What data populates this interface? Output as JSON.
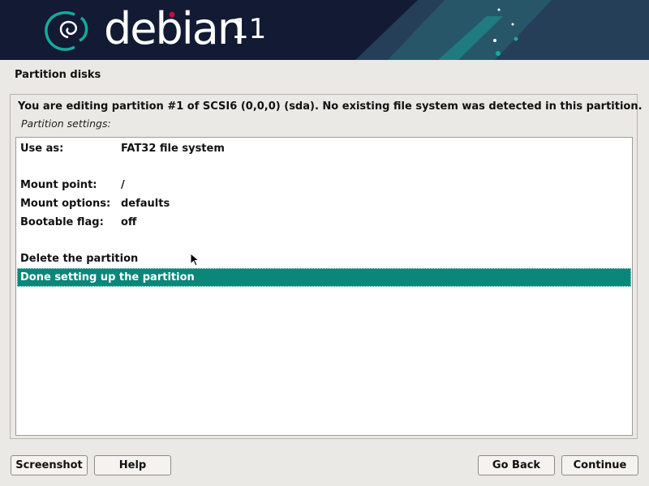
{
  "banner": {
    "name": "debian",
    "version": "11"
  },
  "page_title": "Partition disks",
  "description": "You are editing partition #1 of SCSI6 (0,0,0) (sda). No existing file system was detected in this partition.",
  "settings_label": "Partition settings:",
  "options": [
    {
      "label": "Use as:",
      "value": "FAT32 file system"
    },
    {
      "label": "Mount point:",
      "value": "/"
    },
    {
      "label": "Mount options:",
      "value": "defaults"
    },
    {
      "label": "Bootable flag:",
      "value": "off"
    },
    {
      "label": "Delete the partition",
      "value": ""
    },
    {
      "label": "Done setting up the partition",
      "value": ""
    }
  ],
  "selected_option": "Done setting up the partition",
  "buttons": {
    "screenshot": "Screenshot",
    "help": "Help",
    "go_back": "Go Back",
    "continue": "Continue"
  },
  "colors": {
    "banner_background": "#131a33",
    "banner_accent": "#17a99e",
    "logo_dot": "#c70d42",
    "selection": "#0b877a"
  },
  "icons": [
    "debian-swirl-logo-icon",
    "mouse-pointer-icon"
  ]
}
